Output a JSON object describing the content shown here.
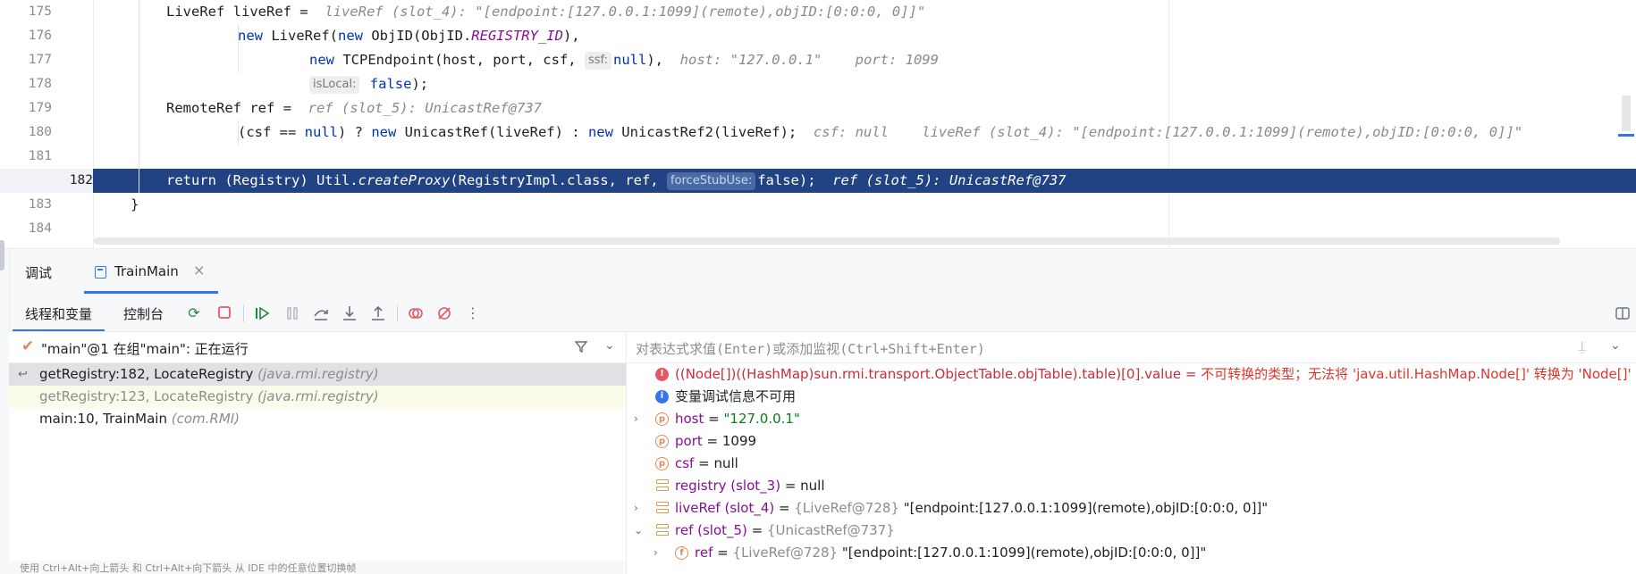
{
  "editor": {
    "lines": [
      {
        "n": "175",
        "indent": 1,
        "parts": [
          {
            "t": "LiveRef liveRef = "
          },
          {
            "cls": "hint",
            "t": " liveRef (slot_4): \"[endpoint:[127.0.0.1:1099](remote),objID:[0:0:0, 0]]\""
          }
        ]
      },
      {
        "n": "176",
        "indent": 2,
        "parts": [
          {
            "cls": "kw",
            "t": "new "
          },
          {
            "t": "LiveRef("
          },
          {
            "cls": "kw",
            "t": "new "
          },
          {
            "t": "ObjID(ObjID."
          },
          {
            "cls": "static",
            "t": "REGISTRY_ID"
          },
          {
            "t": "),"
          }
        ]
      },
      {
        "n": "177",
        "indent": 3,
        "parts": [
          {
            "cls": "kw",
            "t": "new "
          },
          {
            "t": "TCPEndpoint(host, port, csf, "
          },
          {
            "cls": "hint-inline",
            "t": "ssf:"
          },
          {
            "cls": "kw",
            "t": "null"
          },
          {
            "t": "),  "
          },
          {
            "cls": "hint",
            "t": "host: \"127.0.0.1\"    port: 1099"
          }
        ]
      },
      {
        "n": "178",
        "indent": 3,
        "parts": [
          {
            "cls": "hint-inline",
            "t": "isLocal:"
          },
          {
            "cls": "kw",
            "t": " false"
          },
          {
            "t": ");"
          }
        ]
      },
      {
        "n": "179",
        "indent": 1,
        "parts": [
          {
            "t": "RemoteRef ref = "
          },
          {
            "cls": "hint",
            "t": " ref (slot_5): UnicastRef@737"
          }
        ]
      },
      {
        "n": "180",
        "indent": 2,
        "parts": [
          {
            "t": "(csf == "
          },
          {
            "cls": "kw",
            "t": "null"
          },
          {
            "t": ") ? "
          },
          {
            "cls": "kw",
            "t": "new "
          },
          {
            "t": "UnicastRef(liveRef) : "
          },
          {
            "cls": "kw",
            "t": "new "
          },
          {
            "t": "UnicastRef2(liveRef);  "
          },
          {
            "cls": "hint",
            "t": "csf: null    liveRef (slot_4): \"[endpoint:[127.0.0.1:1099](remote),objID:[0:0:0, 0]]\""
          }
        ]
      },
      {
        "n": "181",
        "indent": 0,
        "parts": []
      },
      {
        "n": "182",
        "indent": 1,
        "current": true,
        "parts": [
          {
            "cls": "kw",
            "t": "return "
          },
          {
            "t": "(Registry) Util."
          },
          {
            "cls": "method-it",
            "t": "createProxy"
          },
          {
            "t": "(RegistryImpl."
          },
          {
            "cls": "kw",
            "t": "class"
          },
          {
            "t": ", ref, "
          },
          {
            "cls": "hint-inline",
            "t": "forceStubUse:"
          },
          {
            "cls": "kw",
            "t": "false"
          },
          {
            "t": ");  "
          },
          {
            "cls": "hint",
            "t": "ref (slot_5): UnicastRef@737"
          }
        ]
      },
      {
        "n": "183",
        "indent": 0,
        "parts": [
          {
            "t": "}"
          }
        ]
      },
      {
        "n": "184",
        "indent": 0,
        "parts": []
      }
    ]
  },
  "debug": {
    "title": "调试",
    "run_tab": {
      "label": "TrainMain",
      "close": "×"
    },
    "subtabs": [
      "线程和变量",
      "控制台"
    ],
    "toolbar_icons": [
      "rerun-icon",
      "stop-icon",
      "resume-icon",
      "pause-icon",
      "step-over-icon",
      "step-into-icon",
      "step-out-icon",
      "view-breakpoints-icon",
      "mute-breakpoints-icon",
      "more-icon"
    ],
    "layout_icon": "layout-icon",
    "thread": {
      "label": "\"main\"@1 在组\"main\": 正在运行",
      "status_color": "#e08855"
    },
    "frames": [
      {
        "name": "getRegistry:182, LocateRegistry",
        "pkg": "(java.rmi.registry)",
        "state": "selected"
      },
      {
        "name": "getRegistry:123, LocateRegistry",
        "pkg": "(java.rmi.registry)",
        "state": "dim"
      },
      {
        "name": "main:10, TrainMain",
        "pkg": "(com.RMI)",
        "state": "normal"
      }
    ],
    "footer_hint": "使用 Ctrl+Alt+向上箭头 和 Ctrl+Alt+向下箭头 从 IDE 中的任意位置切换帧",
    "eval_placeholder": "对表达式求值(Enter)或添加监视(Ctrl+Shift+Enter)",
    "variables": [
      {
        "icon": "error",
        "arrow": "",
        "name": "((Node[])((HashMap)sun.rmi.transport.ObjectTable.objTable).table)[0].value",
        "eq": " = ",
        "value": "不可转换的类型；无法将 'java.util.HashMap.Node[]' 转换为 'Node[]'",
        "vcls": "verr",
        "ncls": "err"
      },
      {
        "icon": "info",
        "arrow": "",
        "name": "变量调试信息不可用",
        "eq": "",
        "value": "",
        "vcls": "",
        "ncls": "plain"
      },
      {
        "icon": "p",
        "arrow": "›",
        "name": "host",
        "eq": " = ",
        "value": "\"127.0.0.1\"",
        "vcls": "vstr",
        "ncls": ""
      },
      {
        "icon": "p",
        "arrow": "",
        "name": "port",
        "eq": " = ",
        "value": "1099",
        "vcls": "vplain",
        "ncls": ""
      },
      {
        "icon": "p",
        "arrow": "",
        "name": "csf",
        "eq": " = ",
        "value": "null",
        "vcls": "vplain",
        "ncls": ""
      },
      {
        "icon": "local",
        "arrow": "",
        "name": "registry (slot_3)",
        "eq": " = ",
        "value": "null",
        "vcls": "vplain",
        "ncls": ""
      },
      {
        "icon": "local",
        "arrow": "›",
        "name": "liveRef (slot_4)",
        "eq": " = ",
        "type": "{LiveRef@728} ",
        "value": "\"[endpoint:[127.0.0.1:1099](remote),objID:[0:0:0, 0]]\"",
        "vcls": "vplain",
        "ncls": ""
      },
      {
        "icon": "local",
        "arrow": "⌄",
        "name": "ref (slot_5)",
        "eq": " = ",
        "type": "{UnicastRef@737}",
        "value": "",
        "vcls": "vplain",
        "ncls": ""
      },
      {
        "icon": "f",
        "arrow": "›",
        "indent": true,
        "name": "ref",
        "eq": " = ",
        "type": "{LiveRef@728} ",
        "value": "\"[endpoint:[127.0.0.1:1099](remote),objID:[0:0:0, 0]]\"",
        "vcls": "vplain",
        "ncls": ""
      }
    ]
  }
}
